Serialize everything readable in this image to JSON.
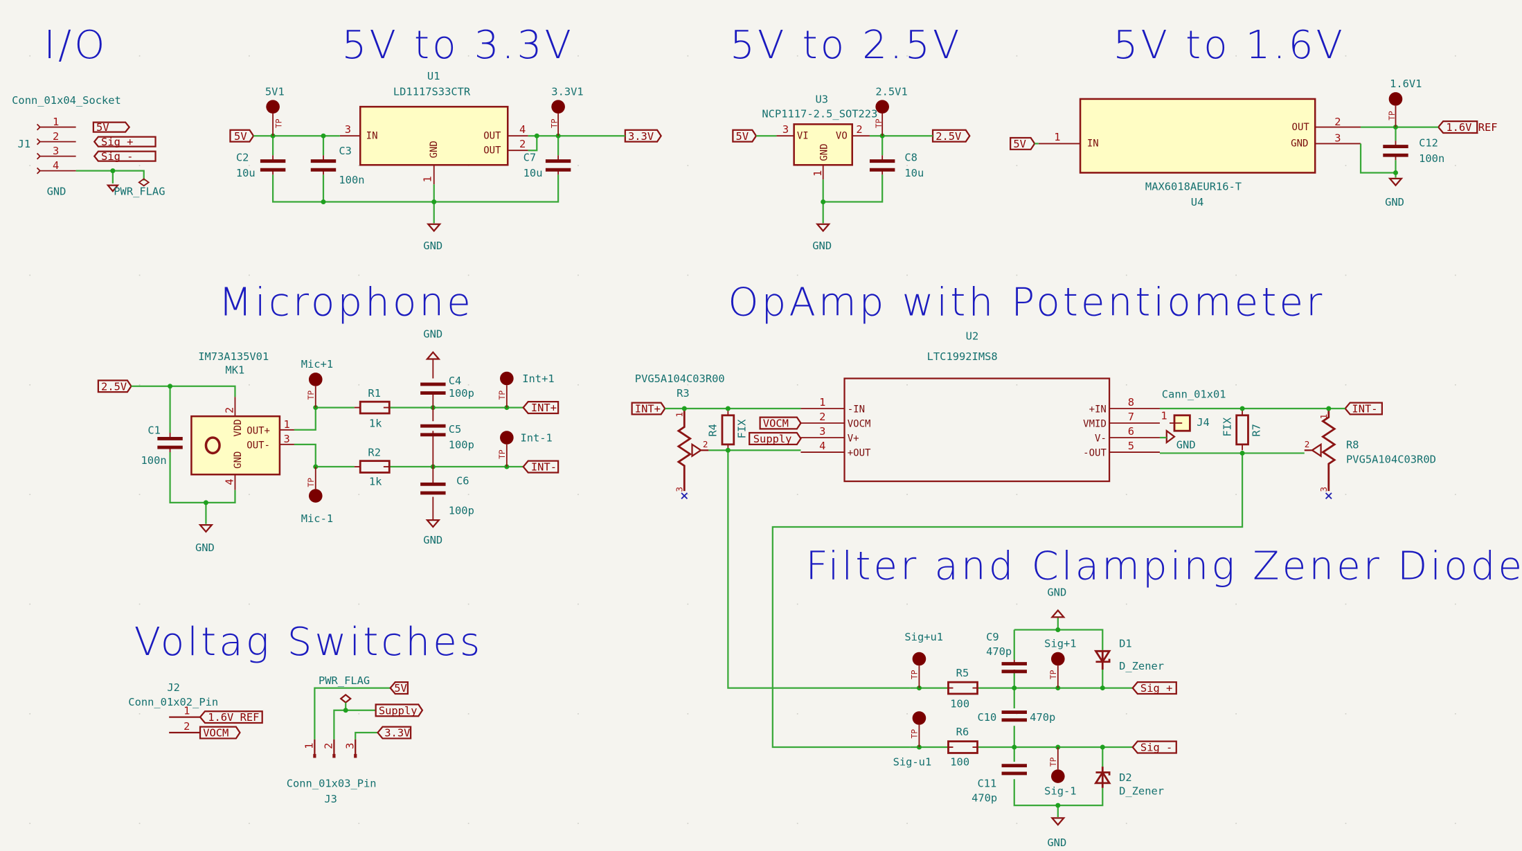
{
  "sections": {
    "io": "I/O",
    "v33": "5V to 3.3V",
    "v25": "5V to 2.5V",
    "v16": "5V to 1.6V",
    "mic": "Microphone",
    "opamp": "OpAmp with Potentiometer",
    "filter": "Filter and Clamping Zener Diode",
    "switches": "Voltag Switches"
  },
  "io": {
    "j1_value": "Conn_01x04_Socket",
    "j1_ref": "J1",
    "pins": [
      "1",
      "2",
      "3",
      "4"
    ],
    "labels": [
      "5V",
      "Sig +",
      "Sig -"
    ],
    "gnd": "GND",
    "pwr_flag": "PWR_FLAG"
  },
  "reg33": {
    "u_ref": "U1",
    "u_value": "LD1117S33CTR",
    "pin_in": "IN",
    "pin_out": "OUT",
    "pin_out2": "OUT",
    "pin_gnd": "GND",
    "pn_in": "3",
    "pn_out": "4",
    "pn_out2": "2",
    "pn_gnd": "1",
    "tp_in": "5V1",
    "tp_out": "3.3V1",
    "tp_label": "TP",
    "in_label": "5V",
    "out_label": "3.3V",
    "c2": "C2",
    "c2v": "10u",
    "c3": "C3",
    "c3v": "100n",
    "c7": "C7",
    "c7v": "10u",
    "gnd": "GND"
  },
  "reg25": {
    "u_ref": "U3",
    "u_value": "NCP1117-2.5_SOT223",
    "pin_vi": "VI",
    "pin_vo": "VO",
    "pin_gnd": "GND",
    "pn_vi": "3",
    "pn_vo": "2",
    "pn_gnd": "1",
    "tp": "2.5V1",
    "tp_label": "TP",
    "in_label": "5V",
    "out_label": "2.5V",
    "c8": "C8",
    "c8v": "10u",
    "gnd": "GND"
  },
  "reg16": {
    "u_ref": "U4",
    "u_value": "MAX6018AEUR16-T",
    "pin_in": "IN",
    "pin_out": "OUT",
    "pin_gnd": "GND",
    "pn_in": "1",
    "pn_out": "2",
    "pn_gnd": "3",
    "tp": "1.6V1",
    "tp_label": "TP",
    "in_label": "5V",
    "out_label": "1.6V_REF",
    "c12": "C12",
    "c12v": "100n",
    "gnd": "GND"
  },
  "mic": {
    "mk_value": "IM73A135V01",
    "mk_ref": "MK1",
    "pin_vdd": "VDD",
    "pin_gnd": "GND",
    "pin_outp": "OUT+",
    "pin_outn": "OUT-",
    "pn_vdd": "2",
    "pn_gnd": "4",
    "pn_outp": "1",
    "pn_outn": "3",
    "supply_label": "2.5V",
    "c1": "C1",
    "c1v": "100n",
    "tp_p": "Mic+1",
    "tp_n": "Mic-1",
    "tp_label": "TP",
    "r1": "R1",
    "r1v": "1k",
    "r2": "R2",
    "r2v": "1k",
    "c4": "C4",
    "c4v": "100p",
    "c5": "C5",
    "c5v": "100p",
    "c6": "C6",
    "c6v": "100p",
    "tp_ip": "Int+1",
    "tp_in": "Int-1",
    "out_p": "INT+",
    "out_n": "INT-",
    "gnd": "GND"
  },
  "opamp": {
    "u_ref": "U2",
    "u_value": "LTC1992IMS8",
    "left_pins": [
      {
        "num": "1",
        "name": "-IN"
      },
      {
        "num": "2",
        "name": "VOCM"
      },
      {
        "num": "3",
        "name": "V+"
      },
      {
        "num": "4",
        "name": "+OUT"
      }
    ],
    "right_pins": [
      {
        "num": "8",
        "name": "+IN"
      },
      {
        "num": "7",
        "name": "VMID"
      },
      {
        "num": "6",
        "name": "V-"
      },
      {
        "num": "5",
        "name": "-OUT"
      }
    ],
    "r3_value": "PVG5A104C03R00",
    "r3_ref": "R3",
    "r8_value": "PVG5A104C03R0D",
    "r8_ref": "R8",
    "r4": "R4",
    "r4v": "FIX",
    "r7": "R7",
    "r7v": "FIX",
    "pot_pins": [
      "1",
      "2",
      "3"
    ],
    "in_label": "INT+",
    "in_label2": "INT-",
    "vocm": "VOCM",
    "supply": "Supply",
    "j4_value": "Cann_01x01",
    "j4_ref": "J4",
    "j4_pin": "1",
    "gnd": "GND"
  },
  "filter": {
    "tp_pu": "Sig+u1",
    "tp_nu": "Sig-u1",
    "tp_p": "Sig+1",
    "tp_n": "Sig-1",
    "tp_label": "TP",
    "r5": "R5",
    "r5v": "100",
    "r6": "R6",
    "r6v": "100",
    "c9": "C9",
    "c9v": "470p",
    "c10": "C10",
    "c10v": "470p",
    "c11": "C11",
    "c11v": "470p",
    "d1": "D1",
    "d1v": "D_Zener",
    "d2": "D2",
    "d2v": "D_Zener",
    "out_p": "Sig +",
    "out_n": "Sig -",
    "gnd": "GND"
  },
  "switches": {
    "j2_ref": "J2",
    "j2_value": "Conn_01x02_Pin",
    "j2_pins": [
      "1",
      "2"
    ],
    "j2_labels": [
      "1.6V_REF",
      "VOCM"
    ],
    "j3_ref": "J3",
    "j3_value": "Conn_01x03_Pin",
    "j3_pins": [
      "1",
      "2",
      "3"
    ],
    "pwr_flag": "PWR_FLAG",
    "labels": [
      "5V",
      "Supply",
      "3.3V"
    ]
  }
}
